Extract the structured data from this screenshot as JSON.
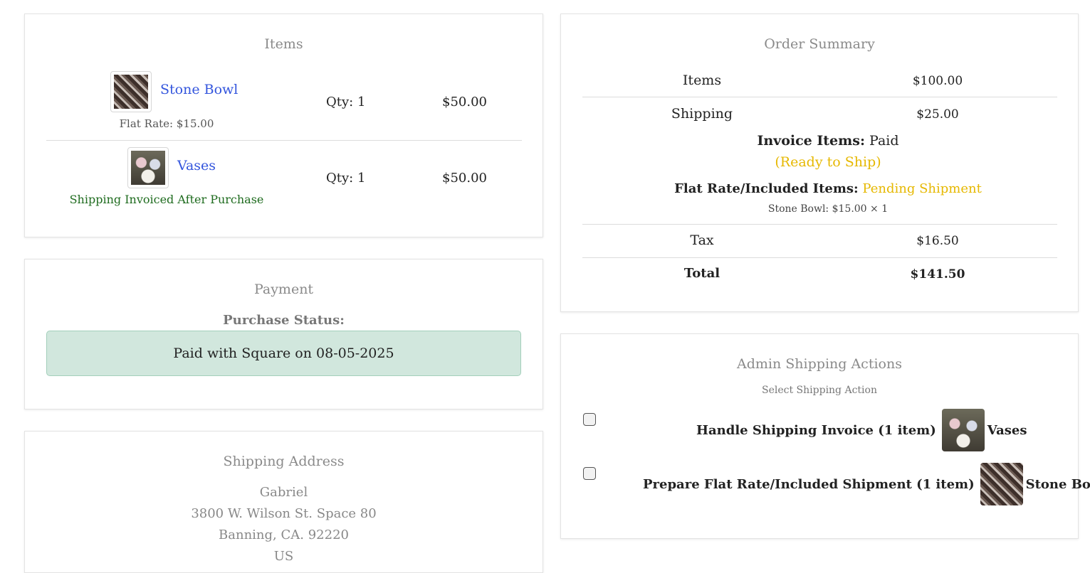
{
  "items_card": {
    "title": "Items",
    "items": [
      {
        "name": "Stone Bowl",
        "note": "Flat Rate: $15.00",
        "qty": "Qty: 1",
        "price": "$50.00",
        "image_icon": "stone-bowl-image"
      },
      {
        "name": "Vases",
        "note": "Shipping Invoiced After Purchase",
        "qty": "Qty: 1",
        "price": "$50.00",
        "image_icon": "vases-image"
      }
    ]
  },
  "payment_card": {
    "title": "Payment",
    "status_label": "Purchase Status:",
    "status_text": "Paid with Square on 08-05-2025"
  },
  "address_card": {
    "title": "Shipping Address",
    "lines": [
      "Gabriel",
      "3800 W. Wilson St. Space 80",
      "Banning, CA. 92220",
      "US"
    ]
  },
  "summary_card": {
    "title": "Order Summary",
    "items_label": "Items",
    "items_value": "$100.00",
    "shipping_label": "Shipping",
    "shipping_value": "$25.00",
    "invoice_items_label": "Invoice Items:",
    "invoice_items_value": "Paid",
    "invoice_items_status": "(Ready to Ship)",
    "flat_rate_label": "Flat Rate/Included Items:",
    "flat_rate_value": "Pending Shipment",
    "flat_rate_detail": "Stone Bowl: $15.00 × 1",
    "tax_label": "Tax",
    "tax_value": "$16.50",
    "total_label": "Total",
    "total_value": "$141.50"
  },
  "admin_card": {
    "title": "Admin Shipping Actions",
    "subtitle": "Select Shipping Action",
    "actions": [
      {
        "label": "Handle Shipping Invoice (1 item)",
        "item_name": "Vases",
        "checked": false
      },
      {
        "label": "Prepare Flat Rate/Included Shipment (1 item)",
        "item_name": "Stone Bowl",
        "checked": false
      }
    ]
  },
  "colors": {
    "link": "#3355dd",
    "success_text": "#1e6b1e",
    "warning_text": "#e6b800",
    "paid_box_bg": "#d1e7dd",
    "muted_text": "#888888"
  }
}
